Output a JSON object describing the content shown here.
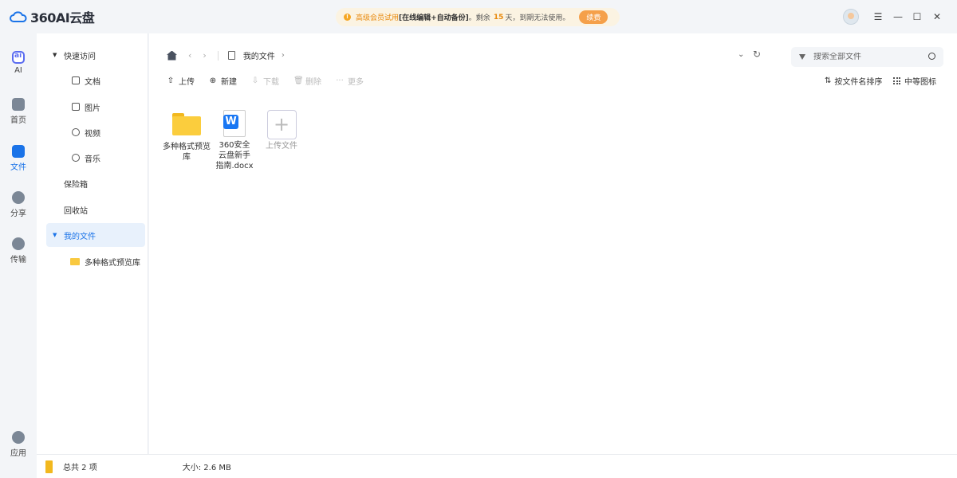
{
  "app": {
    "logo_text": "360AI云盘"
  },
  "promo": {
    "trial_label": "高级会员试用",
    "features": "[在线编辑+自动备份]",
    "remaining_prefix": "。剩余",
    "days_number": "15",
    "days_suffix": "天，",
    "expire_text": "到期无法使用。",
    "renew_button": "续费"
  },
  "rail": {
    "items": [
      {
        "label": "AI",
        "icon": "ai-icon"
      },
      {
        "label": "首页",
        "icon": "home-icon"
      },
      {
        "label": "文件",
        "icon": "folder-icon"
      },
      {
        "label": "分享",
        "icon": "share-icon"
      },
      {
        "label": "传输",
        "icon": "cloud-transfer-icon"
      },
      {
        "label": "应用",
        "icon": "apps-icon"
      }
    ]
  },
  "sidebar": {
    "quick_access": "快速访问",
    "sub": [
      "文档",
      "图片",
      "视频",
      "音乐"
    ],
    "vault": "保险箱",
    "recycle": "回收站",
    "my_files": "我的文件",
    "child_folder": "多种格式预览库"
  },
  "nav": {
    "breadcrumb": "我的文件"
  },
  "search": {
    "placeholder": "搜索全部文件"
  },
  "toolbar": {
    "upload": "上传",
    "new": "新建",
    "download": "下载",
    "delete": "删除",
    "more": "更多",
    "sort": "按文件名排序",
    "view": "中等图标"
  },
  "files": [
    {
      "name": "多种格式预览库",
      "type": "folder"
    },
    {
      "name": "360安全云盘新手指南.docx",
      "type": "docx"
    }
  ],
  "upload_tile": "上传文件",
  "status": {
    "total": "总共 2 项",
    "size": "大小: 2.6 MB"
  },
  "colors": {
    "accent": "#1a73e8",
    "selected_bg": "#e8f1fc",
    "folder_yellow": "#fbcd3d",
    "promo_bg": "#fbf3e2",
    "renew": "#f5a04a"
  }
}
